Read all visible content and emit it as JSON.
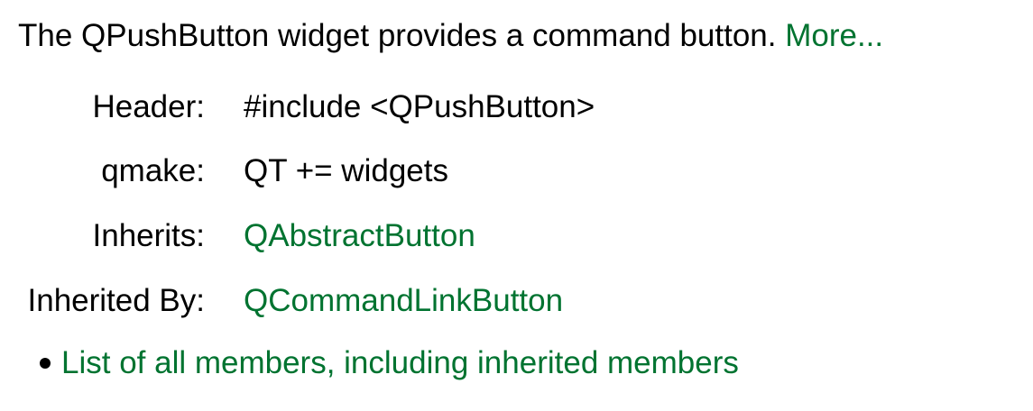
{
  "intro": {
    "text": "The QPushButton widget provides a command button.",
    "more_link": "More..."
  },
  "details": [
    {
      "label": "Header:",
      "value": "#include <QPushButton>",
      "is_link": false
    },
    {
      "label": "qmake:",
      "value": "QT += widgets",
      "is_link": false
    },
    {
      "label": "Inherits:",
      "value": "QAbstractButton",
      "is_link": true
    },
    {
      "label": "Inherited By:",
      "value": "QCommandLinkButton",
      "is_link": true
    }
  ],
  "members_link": "List of all members, including inherited members",
  "colors": {
    "link": "#007330",
    "text": "#000000",
    "background": "#ffffff"
  }
}
